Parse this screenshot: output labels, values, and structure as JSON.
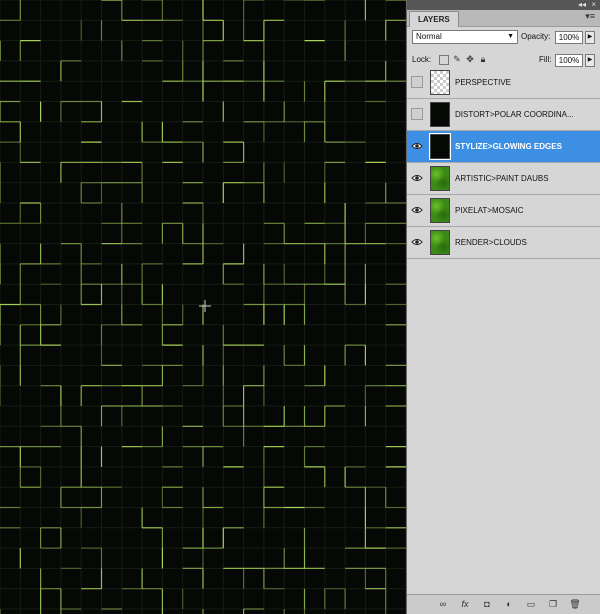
{
  "panel": {
    "tab_label": "LAYERS",
    "menu_icon": "panel-menu-icon",
    "blend_mode": "Normal",
    "opacity_label": "Opacity:",
    "opacity_value": "100%",
    "lock_label": "Lock:",
    "fill_label": "Fill:",
    "fill_value": "100%"
  },
  "layers": [
    {
      "name": "PERSPECTIVE",
      "visible": false,
      "selected": false,
      "thumb": "checker"
    },
    {
      "name": "DISTORT>POLAR COORDINA...",
      "visible": false,
      "selected": false,
      "thumb": "dark"
    },
    {
      "name": "STYLIZE>GLOWING EDGES",
      "visible": true,
      "selected": true,
      "thumb": "dark"
    },
    {
      "name": "ARTISTIC>PAINT DAUBS",
      "visible": true,
      "selected": false,
      "thumb": "green"
    },
    {
      "name": "PIXELAT>MOSAIC",
      "visible": true,
      "selected": false,
      "thumb": "green"
    },
    {
      "name": "RENDER>CLOUDS",
      "visible": true,
      "selected": false,
      "thumb": "green"
    }
  ],
  "colors": {
    "canvas_bg": "#050805",
    "glow": "#b4e060",
    "selection": "#3d8fe3"
  }
}
